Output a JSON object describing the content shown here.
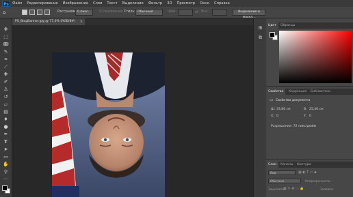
{
  "app": {
    "logo": "Ps"
  },
  "menu": [
    "Файл",
    "Редактирование",
    "Изображение",
    "Слои",
    "Текст",
    "Выделение",
    "Фильтр",
    "3D",
    "Просмотр",
    "Окно",
    "Справка"
  ],
  "options": {
    "feather_label": "Растушевка:",
    "feather_value": "0 пикс.",
    "antialias_label": "Сглаживание",
    "style_label": "Стиль:",
    "style_value": "Обычный",
    "width_label": "Шир.:",
    "height_label": "Выс.:",
    "refine_button": "Выделение и маска..."
  },
  "document": {
    "tab_title": "PS_BlogBanner.jpg @ 77,3% (RGB/8#)",
    "close": "×"
  },
  "color_panel": {
    "tabs": [
      "Цвет",
      "Образцы"
    ]
  },
  "properties_panel": {
    "tabs": [
      "Свойства",
      "Коррекция",
      "Библиотеки"
    ],
    "title": "Свойства документа",
    "w_label": "Ш:",
    "w_value": "33,86 см",
    "h_label": "В:",
    "h_value": "25,40 см",
    "x_label": "X:",
    "x_value": "0",
    "y_label": "Y:",
    "y_value": "0",
    "resolution": "Разрешение: 72 пикс/дюйм"
  },
  "layers_panel": {
    "tabs": [
      "Слои",
      "Каналы",
      "Контуры"
    ],
    "kind_label": "Вид",
    "blend_mode": "Обычные",
    "opacity_label": "Непрозрачность:",
    "lock_label": "Закрепить:",
    "fill_label": "Заливка:"
  }
}
